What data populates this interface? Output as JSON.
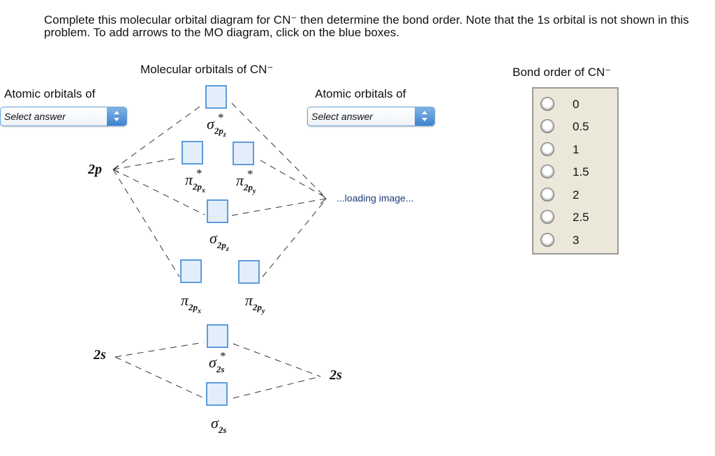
{
  "instructions": "Complete this molecular orbital diagram for CN⁻ then determine the bond order. Note that the 1s orbital is not shown in this problem. To add arrows to the MO diagram, click on the blue boxes.",
  "diagram": {
    "mo_header": "Molecular orbitals of CN⁻",
    "left_atomic": {
      "header": "Atomic orbitals of",
      "select_value": "Select answer"
    },
    "right_atomic": {
      "header": "Atomic orbitals of",
      "select_value": "Select answer"
    },
    "atomic_labels": {
      "left_2p": "2p",
      "left_2s": "2s",
      "right_2s": "2s"
    },
    "right_2p_placeholder": "...loading image...",
    "molecular_orbitals": [
      {
        "id": "sigma-star-2pz",
        "symbol": "σ",
        "sub": "2p",
        "subsub": "z",
        "star": "*"
      },
      {
        "id": "pi-star-2px",
        "symbol": "π",
        "sub": "2p",
        "subsub": "x",
        "star": "*"
      },
      {
        "id": "pi-star-2py",
        "symbol": "π",
        "sub": "2p",
        "subsub": "y",
        "star": "*"
      },
      {
        "id": "sigma-2pz",
        "symbol": "σ",
        "sub": "2p",
        "subsub": "z",
        "star": ""
      },
      {
        "id": "pi-2px",
        "symbol": "π",
        "sub": "2p",
        "subsub": "x",
        "star": ""
      },
      {
        "id": "pi-2py",
        "symbol": "π",
        "sub": "2p",
        "subsub": "y",
        "star": ""
      },
      {
        "id": "sigma-star-2s",
        "symbol": "σ",
        "sub": "2s",
        "subsub": "",
        "star": "*"
      },
      {
        "id": "sigma-2s",
        "symbol": "σ",
        "sub": "2s",
        "subsub": "",
        "star": ""
      }
    ]
  },
  "bond_order": {
    "header": "Bond order of CN⁻",
    "options": [
      "0",
      "0.5",
      "1",
      "1.5",
      "2",
      "2.5",
      "3"
    ],
    "selected": null
  }
}
